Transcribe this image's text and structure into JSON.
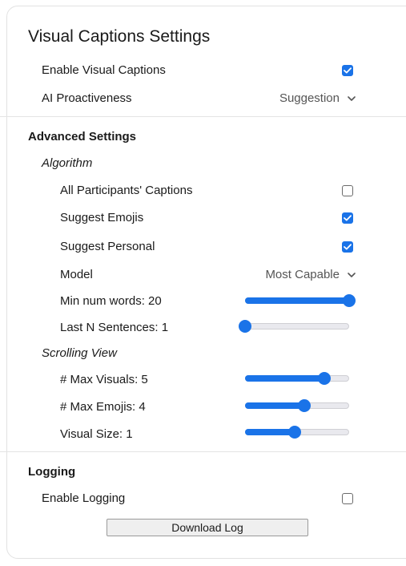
{
  "title": "Visual Captions Settings",
  "general": {
    "enable_visual_captions": {
      "label": "Enable Visual Captions",
      "checked": true
    },
    "ai_proactiveness": {
      "label": "AI Proactiveness",
      "value": "Suggestion"
    }
  },
  "advanced": {
    "title": "Advanced Settings",
    "algorithm": {
      "title": "Algorithm",
      "all_participants_captions": {
        "label": "All Participants' Captions",
        "checked": false
      },
      "suggest_emojis": {
        "label": "Suggest Emojis",
        "checked": true
      },
      "suggest_personal": {
        "label": "Suggest Personal",
        "checked": true
      },
      "model": {
        "label": "Model",
        "value": "Most Capable"
      },
      "min_num_words": {
        "label": "Min num words: 20",
        "fraction": 1.0
      },
      "last_n_sentences": {
        "label": "Last N Sentences: 1",
        "fraction": 0.0
      }
    },
    "scrolling_view": {
      "title": "Scrolling View",
      "max_visuals": {
        "label": "# Max Visuals: 5",
        "fraction": 0.76
      },
      "max_emojis": {
        "label": "# Max Emojis: 4",
        "fraction": 0.57
      },
      "visual_size": {
        "label": "Visual Size: 1",
        "fraction": 0.48
      }
    }
  },
  "logging": {
    "title": "Logging",
    "enable_logging": {
      "label": "Enable Logging",
      "checked": false
    },
    "download_button": "Download Log"
  },
  "colors": {
    "accent": "#1a73e8"
  }
}
